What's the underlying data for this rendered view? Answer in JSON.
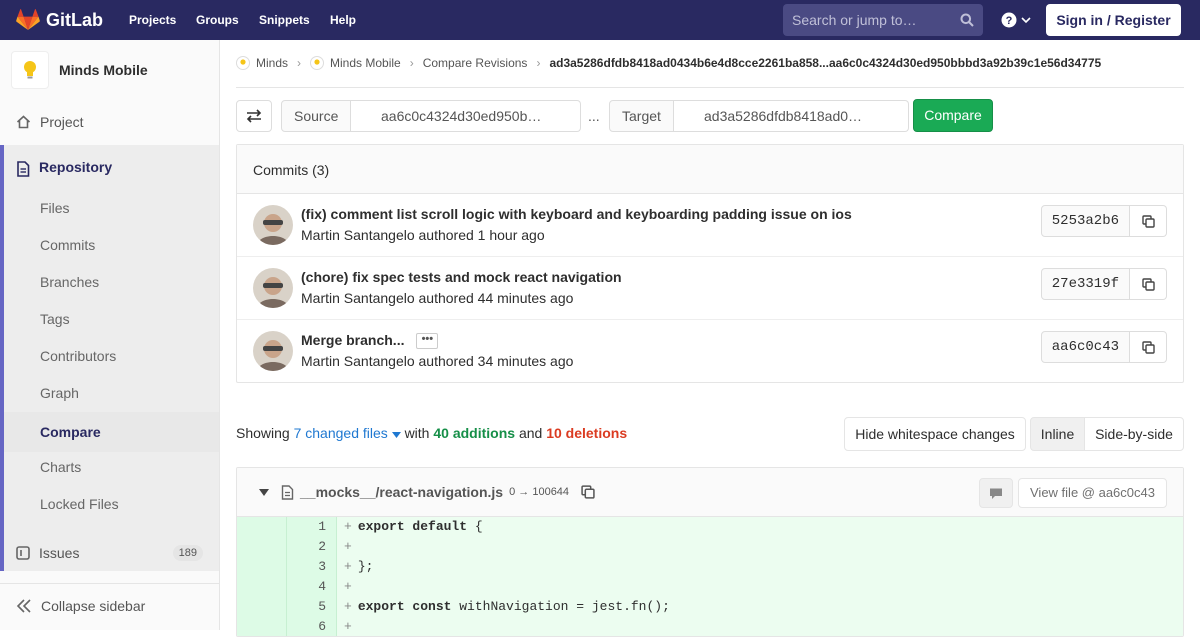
{
  "topbar": {
    "brand": "GitLab",
    "nav": [
      "Projects",
      "Groups",
      "Snippets",
      "Help"
    ],
    "search_placeholder": "Search or jump to…",
    "sign_in": "Sign in / Register"
  },
  "sidebar": {
    "project_name": "Minds Mobile",
    "project_item": "Project",
    "repository": "Repository",
    "sub_items": [
      "Files",
      "Commits",
      "Branches",
      "Tags",
      "Contributors",
      "Graph",
      "Compare",
      "Charts",
      "Locked Files"
    ],
    "active_sub": "Compare",
    "issues": "Issues",
    "issues_count": "189",
    "collapse": "Collapse sidebar"
  },
  "breadcrumb": {
    "items": [
      "Minds",
      "Minds Mobile",
      "Compare Revisions"
    ],
    "current": "ad3a5286dfdb8418ad0434b6e4d8cce2261ba858...aa6c0c4324d30ed950bbbd3a92b39c1e56d34775"
  },
  "compare_form": {
    "source_label": "Source",
    "source_value": "aa6c0c4324d30ed950b…",
    "separator": "...",
    "target_label": "Target",
    "target_value": "ad3a5286dfdb8418ad0…",
    "compare_label": "Compare"
  },
  "commits": {
    "header": "Commits (3)",
    "items": [
      {
        "title": "(fix) comment list scroll logic with keyboard and keyboarding padding issue on ios",
        "meta": "Martin Santangelo authored 1 hour ago",
        "sha": "5253a2b6"
      },
      {
        "title": "(chore) fix spec tests and mock react navigation",
        "meta": "Martin Santangelo authored 44 minutes ago",
        "sha": "27e3319f"
      },
      {
        "title": "Merge branch...",
        "meta": "Martin Santangelo authored 34 minutes ago",
        "sha": "aa6c0c43"
      }
    ]
  },
  "diff_summary": {
    "showing": "Showing",
    "changed_files": "7 changed files",
    "with": "with",
    "additions": "40 additions",
    "and": "and",
    "deletions": "10 deletions",
    "hide_whitespace": "Hide whitespace changes",
    "inline": "Inline",
    "side_by_side": "Side-by-side"
  },
  "file": {
    "path": "__mocks__/react-navigation.js",
    "mode": "0 → 100644",
    "view_file": "View file @ aa6c0c43",
    "lines": [
      {
        "n": "1",
        "kw": "export default",
        "rest": " {"
      },
      {
        "n": "2",
        "kw": "",
        "rest": ""
      },
      {
        "n": "3",
        "kw": "",
        "rest": "};"
      },
      {
        "n": "4",
        "kw": "",
        "rest": ""
      },
      {
        "n": "5",
        "kw": "export const",
        "rest": " withNavigation = jest.fn();"
      },
      {
        "n": "6",
        "kw": "",
        "rest": ""
      }
    ]
  },
  "colors": {
    "topbar": "#292961",
    "compare_button": "#1aaa55",
    "additions": "#168f48",
    "deletions": "#db3b21",
    "link": "#1f78d1"
  }
}
